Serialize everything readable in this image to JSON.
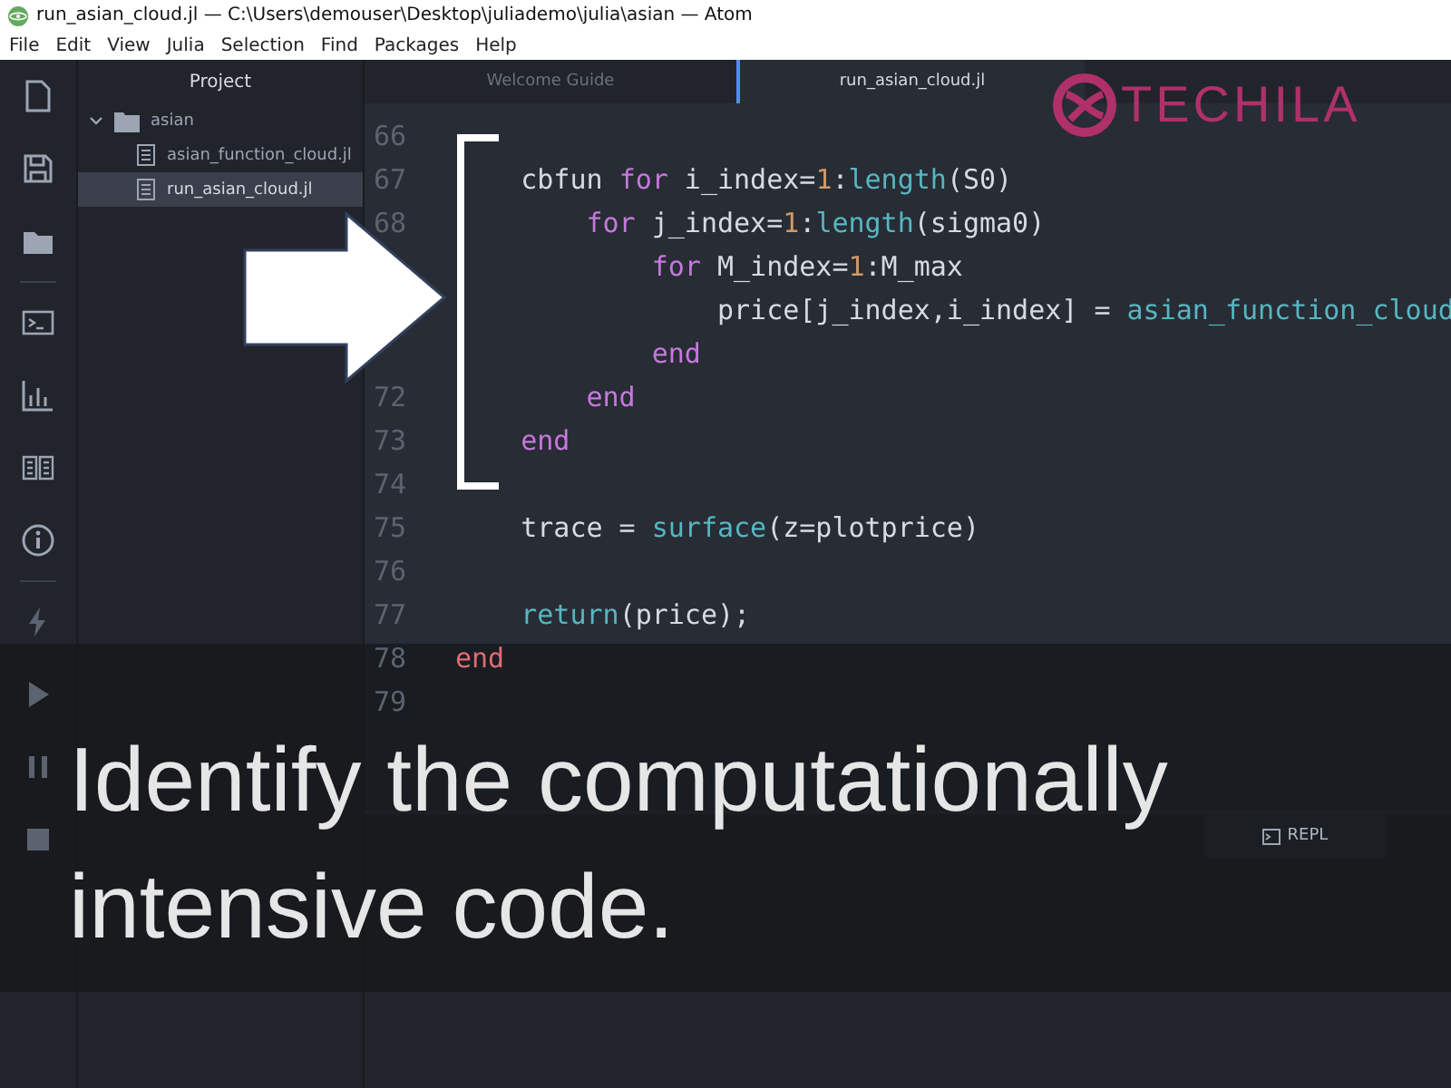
{
  "window": {
    "title": "run_asian_cloud.jl — C:\\Users\\demouser\\Desktop\\juliademo\\julia\\asian — Atom"
  },
  "menu": [
    "File",
    "Edit",
    "View",
    "Julia",
    "Selection",
    "Find",
    "Packages",
    "Help"
  ],
  "tool_bar": [
    {
      "kind": "file"
    },
    {
      "kind": "save"
    },
    {
      "kind": "folder"
    },
    {
      "kind": "divider"
    },
    {
      "kind": "terminal"
    },
    {
      "kind": "chart"
    },
    {
      "kind": "book"
    },
    {
      "kind": "info"
    },
    {
      "kind": "divider"
    },
    {
      "kind": "bolt"
    },
    {
      "kind": "play"
    },
    {
      "kind": "pause"
    },
    {
      "kind": "stop"
    }
  ],
  "project": {
    "title": "Project",
    "tree": [
      {
        "name": "asian",
        "kind": "folder",
        "expanded": true,
        "selected": false,
        "children": [
          {
            "name": "asian_function_cloud.jl",
            "kind": "file",
            "selected": false
          },
          {
            "name": "run_asian_cloud.jl",
            "kind": "file",
            "selected": true
          }
        ]
      }
    ]
  },
  "tabs": [
    {
      "label": "Welcome Guide",
      "selected": false
    },
    {
      "label": "run_asian_cloud.jl",
      "selected": true
    }
  ],
  "code": [
    {
      "n": "66"
    },
    {
      "n": "67",
      "tokens": [
        {
          "t": "    cbfun ",
          "kind": "plain"
        },
        {
          "t": "for",
          "kind": "keyword"
        },
        {
          "t": " i_index=",
          "kind": "plain"
        },
        {
          "t": "1",
          "kind": "number"
        },
        {
          "t": ":",
          "kind": "plain"
        },
        {
          "t": "length",
          "kind": "func"
        },
        {
          "t": "(S0)",
          "kind": "plain"
        }
      ]
    },
    {
      "n": "68",
      "tokens": [
        {
          "t": "        for",
          "kind": "keyword"
        },
        {
          "t": " j_index=",
          "kind": "plain"
        },
        {
          "t": "1",
          "kind": "number"
        },
        {
          "t": ":",
          "kind": "plain"
        },
        {
          "t": "length",
          "kind": "func"
        },
        {
          "t": "(sigma0)",
          "kind": "plain"
        }
      ]
    },
    {
      "tokens": [
        {
          "t": "            for",
          "kind": "keyword"
        },
        {
          "t": " M_index=",
          "kind": "plain"
        },
        {
          "t": "1",
          "kind": "number"
        },
        {
          "t": ":M_max",
          "kind": "plain"
        }
      ]
    },
    {
      "tokens": [
        {
          "t": "                price[j_index,i_index] = ",
          "kind": "plain"
        },
        {
          "t": "asian_function_cloud",
          "kind": "func"
        }
      ]
    },
    {
      "tokens": [
        {
          "t": "            end",
          "kind": "keyword"
        }
      ]
    },
    {
      "n": "72",
      "tokens": [
        {
          "t": "        end",
          "kind": "keyword"
        }
      ]
    },
    {
      "n": "73",
      "tokens": [
        {
          "t": "    end",
          "kind": "keyword"
        }
      ]
    },
    {
      "n": "74"
    },
    {
      "n": "75",
      "tokens": [
        {
          "t": "    trace = ",
          "kind": "plain"
        },
        {
          "t": "surface",
          "kind": "func"
        },
        {
          "t": "(z=plotprice)",
          "kind": "plain"
        }
      ]
    },
    {
      "n": "76"
    },
    {
      "n": "77",
      "tokens": [
        {
          "t": "    return",
          "kind": "func"
        },
        {
          "t": "(price);",
          "kind": "plain"
        }
      ]
    },
    {
      "n": "78",
      "tokens": [
        {
          "t": "end",
          "kind": "end"
        }
      ]
    },
    {
      "n": "79"
    }
  ],
  "repl": {
    "tab": "REPL"
  },
  "logo": {
    "text": "TECHILA"
  },
  "caption": "Identify the computationally intensive code."
}
